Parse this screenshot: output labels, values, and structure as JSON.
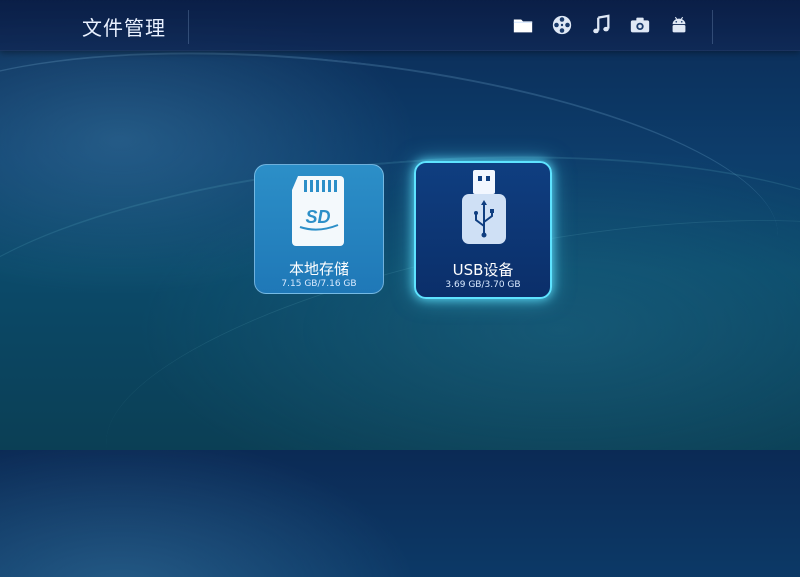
{
  "header": {
    "title": "文件管理",
    "icons": [
      "folder-icon",
      "video-reel-icon",
      "music-note-icon",
      "camera-icon",
      "android-icon"
    ]
  },
  "tiles": [
    {
      "label": "本地存储",
      "size": "7.15 GB/7.16 GB",
      "icon": "sd-card-icon"
    },
    {
      "label": "USB设备",
      "size": "3.69 GB/3.70 GB",
      "icon": "usb-drive-icon"
    }
  ],
  "colors": {
    "focus_glow": "#5ee3ff",
    "tile_local": "#2c8fc8",
    "tile_usb": "#0f3e80"
  }
}
